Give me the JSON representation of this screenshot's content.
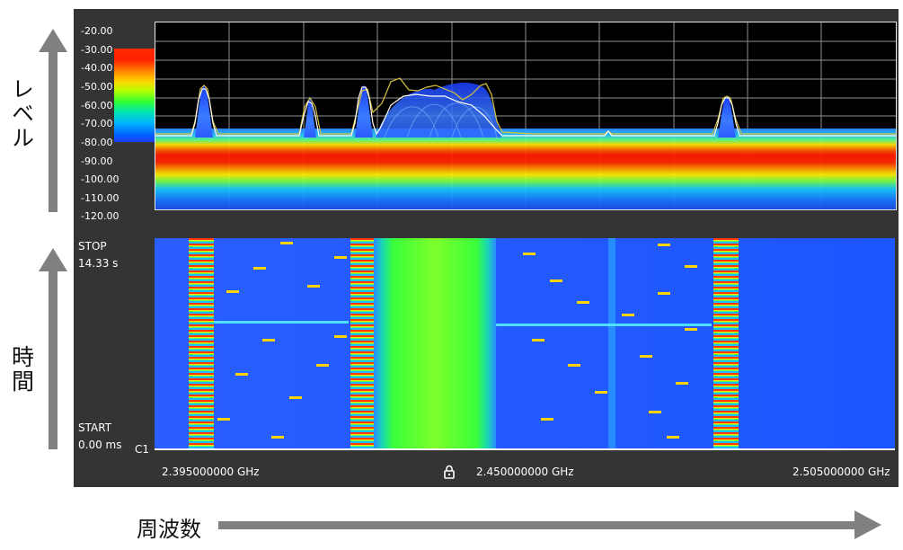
{
  "outer": {
    "level_label": "レベル",
    "time_label": "時間",
    "freq_label": "周波数"
  },
  "level_ticks": [
    "-20.00",
    "-30.00",
    "-40.00",
    "-50.00",
    "-60.00",
    "-70.00",
    "-80.00",
    "-90.00",
    "-100.00",
    "-110.00",
    "-120.00"
  ],
  "spectrogram": {
    "stop_label": "STOP",
    "stop_value": "14.33 s",
    "start_label": "START",
    "start_value": "0.00 ms",
    "channel": "C1"
  },
  "frequency": {
    "start": "2.395000000 GHz",
    "center": "2.450000000 GHz",
    "stop": "2.505000000 GHz"
  },
  "colors": {
    "panel_bg": "#343434",
    "trace": "#ffffff",
    "max_hold": "#d7c33a",
    "spectrogram_bg": "#1e5cff"
  },
  "icons": {
    "lock": "lock-icon"
  }
}
